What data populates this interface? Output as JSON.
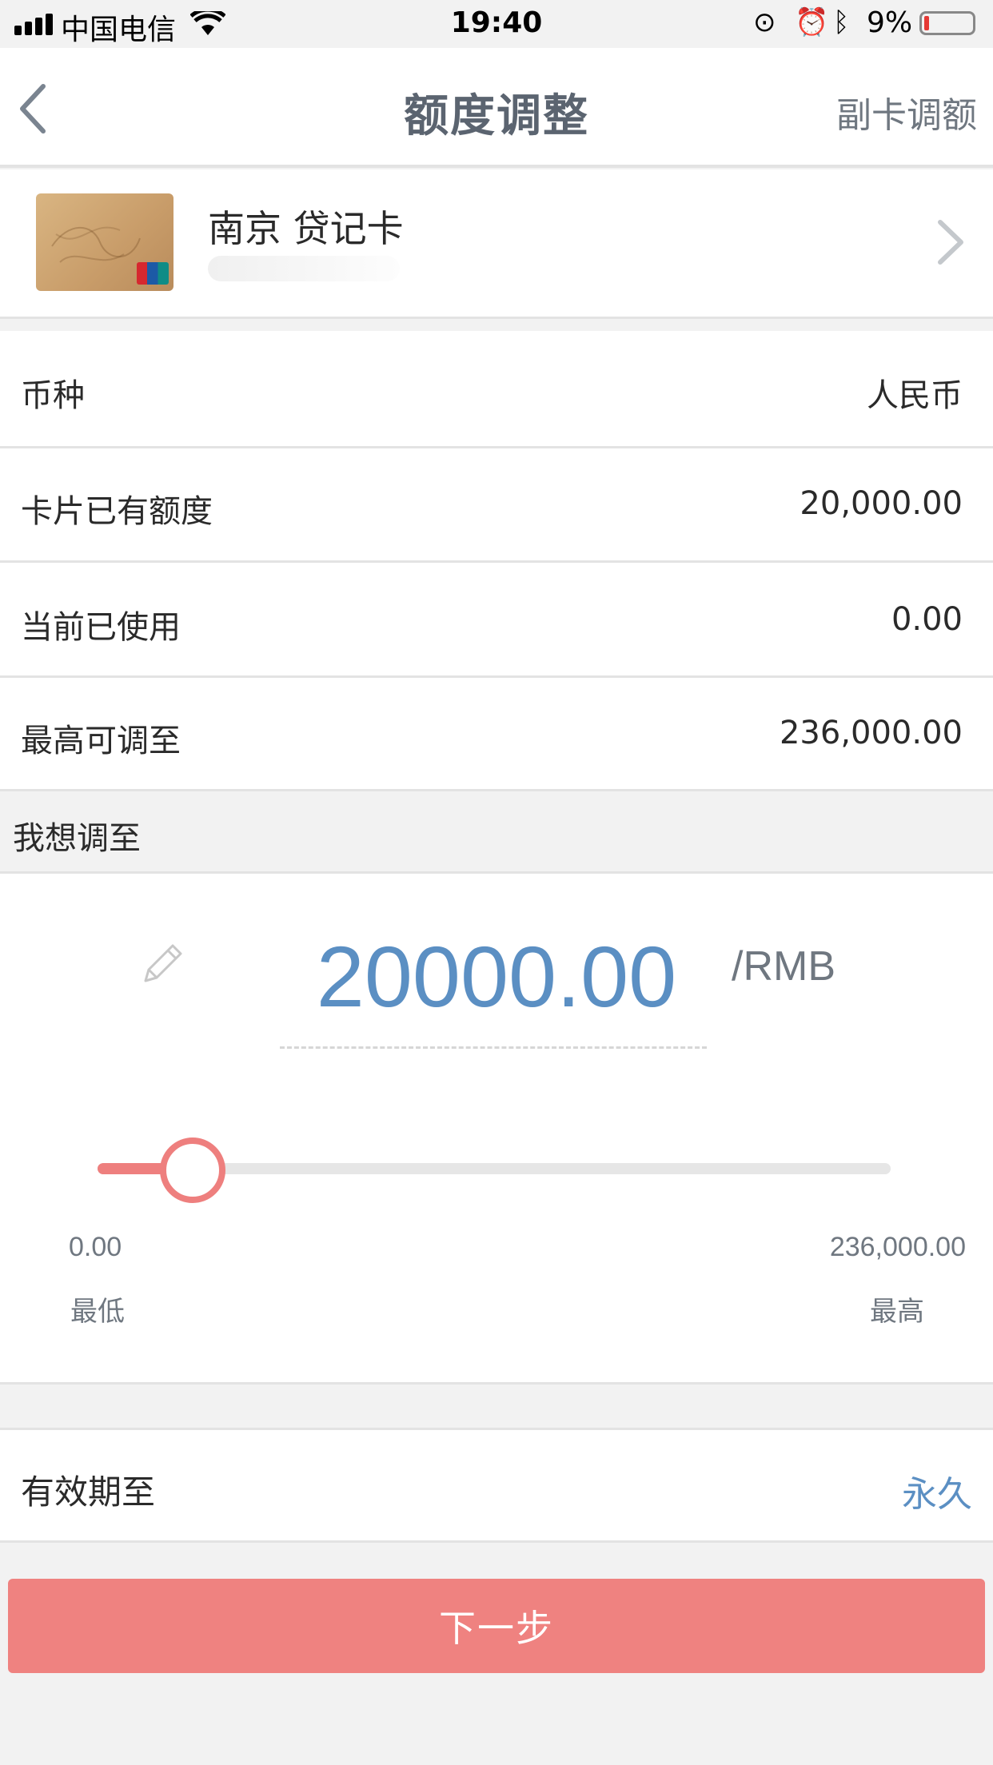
{
  "status_bar": {
    "carrier": "中国电信",
    "time": "19:40",
    "battery": "9%"
  },
  "header": {
    "title": "额度调整",
    "right_action": "副卡调额",
    "back_icon": "chevron-left-icon"
  },
  "card": {
    "name": "南京 贷记卡",
    "chevron_icon": "chevron-right-icon"
  },
  "info_rows": [
    {
      "label": "币种",
      "value": "人民币"
    },
    {
      "label": "卡片已有额度",
      "value": "20,000.00"
    },
    {
      "label": "当前已使用",
      "value": "0.00"
    },
    {
      "label": "最高可调至",
      "value": "236,000.00"
    }
  ],
  "adjust": {
    "section_title": "我想调至",
    "amount": "20000.00",
    "unit": "/RMB",
    "edit_icon": "pencil-icon",
    "slider": {
      "min_value": "0.00",
      "max_value": "236,000.00",
      "min_label": "最低",
      "max_label": "最高",
      "level": 0.12,
      "color": "#ee7f7e"
    }
  },
  "validity": {
    "label": "有效期至",
    "value": "永久"
  },
  "actions": {
    "next_label": "下一步"
  },
  "colors": {
    "accent_blue": "#5b8fc3",
    "primary_button": "#ef8280"
  }
}
